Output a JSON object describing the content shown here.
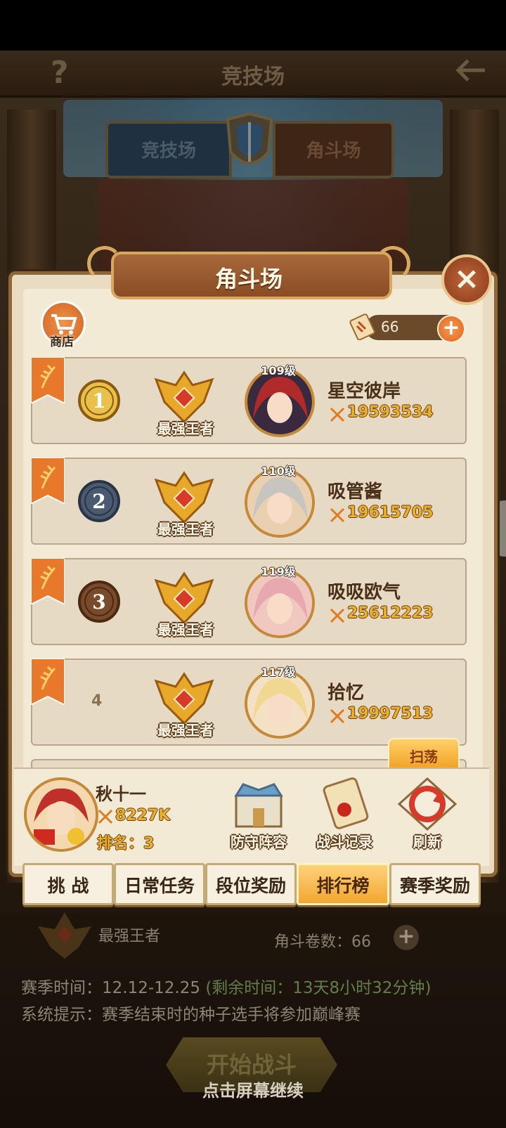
{
  "top_bar": {
    "help_glyph": "?",
    "title": "竞技场",
    "back_icon": "back-arrow-icon"
  },
  "mode_tabs": {
    "left": "竞技场",
    "right": "角斗场"
  },
  "dialog": {
    "title": "角斗场",
    "close_glyph": "×",
    "shop_label": "商店",
    "tickets_value": "66",
    "plus_glyph": "+",
    "rankings": [
      {
        "rank": "1",
        "badge": "最强王者",
        "level": "109级",
        "name": "星空彼岸",
        "power": "19593534"
      },
      {
        "rank": "2",
        "badge": "最强王者",
        "level": "110级",
        "name": "吸管酱",
        "power": "19615705"
      },
      {
        "rank": "3",
        "badge": "最强王者",
        "level": "119级",
        "name": "吸吸欧气",
        "power": "25612223"
      },
      {
        "rank": "4",
        "badge": "最强王者",
        "level": "117级",
        "name": "拾忆",
        "power": "19997513"
      }
    ],
    "sweep_label": "扫荡",
    "player": {
      "name": "秋十一",
      "power": "8227K",
      "rank_text": "排名：3"
    },
    "actions": {
      "defense": "防守阵容",
      "record": "战斗记录",
      "refresh": "刷新"
    },
    "tabs": [
      "挑 战",
      "日常任务",
      "段位奖励",
      "排行榜",
      "赛季奖励"
    ],
    "active_tab_index": 3
  },
  "bottom": {
    "rank_name": "最强王者",
    "tickets_label": "角斗卷数：66",
    "plus_glyph": "+",
    "season_time": "赛季时间：12.12-12.25",
    "remaining": "(剩余时间：13天8小时32分钟)",
    "system_tip": "系统提示：赛季结束时的种子选手将参加巅峰赛",
    "start_button": "开始战斗",
    "continue_hint": "点击屏幕继续"
  },
  "colors": {
    "panel_bg": "#f3ead6",
    "accent_orange": "#f2a630",
    "power_gold": "#e8b030",
    "brown_text": "#4a3018"
  }
}
